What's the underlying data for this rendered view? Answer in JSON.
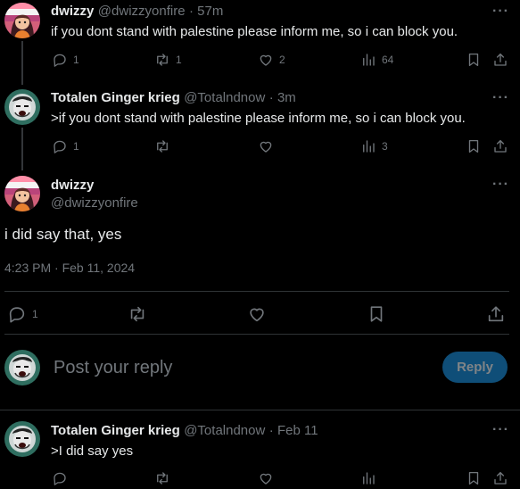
{
  "posts": [
    {
      "name": "dwizzy",
      "handle": "@dwizzyonfire",
      "time": "· 57m",
      "text": "if you dont stand with palestine please inform me, so i can block you.",
      "counts": {
        "reply": "1",
        "repost": "1",
        "like": "2",
        "views": "64"
      }
    },
    {
      "name": "Totalen Ginger krieg",
      "handle": "@Totalndnow",
      "time": "· 3m",
      "text": ">if you dont stand with palestine please inform me, so i can block you.",
      "counts": {
        "reply": "1",
        "repost": "",
        "like": "",
        "views": "3"
      }
    }
  ],
  "focused": {
    "name": "dwizzy",
    "handle": "@dwizzyonfire",
    "text": "i did say that, yes",
    "timestamp": "4:23 PM · Feb 11, 2024",
    "counts": {
      "reply": "1"
    }
  },
  "composer": {
    "placeholder": "Post your reply",
    "button": "Reply"
  },
  "reply": {
    "name": "Totalen Ginger krieg",
    "handle": "@Totalndnow",
    "time": "· Feb 11",
    "text": ">I did say yes"
  },
  "more_glyph": "···",
  "colors": {
    "background": "#000000",
    "text": "#e7e9ea",
    "muted": "#71767b",
    "accent": "#1d9bf0",
    "reply_button": "#0f4e78"
  },
  "icons": [
    "reply-icon",
    "repost-icon",
    "like-icon",
    "views-icon",
    "bookmark-icon",
    "share-icon",
    "more-icon"
  ]
}
